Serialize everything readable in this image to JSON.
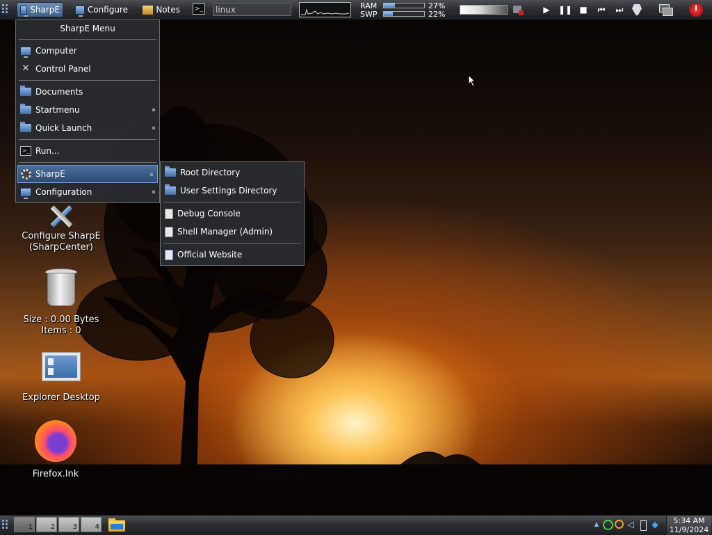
{
  "topbar": {
    "sharpe_label": "SharpE",
    "configure_label": "Configure",
    "notes_label": "Notes",
    "run_value": "linux",
    "ram_label": "RAM",
    "swp_label": "SWP",
    "ram_pct": "27%",
    "swp_pct": "22%",
    "ram_level": 0.27,
    "swp_level": 0.22,
    "volume_level": 0.45
  },
  "menu": {
    "title": "SharpE Menu",
    "items": [
      {
        "label": "Computer",
        "icon": "computer-icon"
      },
      {
        "label": "Control Panel",
        "icon": "tools-icon"
      },
      {
        "label": "Documents",
        "icon": "folder-icon"
      },
      {
        "label": "Startmenu",
        "icon": "folder-icon"
      },
      {
        "label": "Quick Launch",
        "icon": "folder-icon"
      },
      {
        "label": "Run...",
        "icon": "terminal-icon"
      },
      {
        "label": "SharpE",
        "icon": "gear-icon"
      },
      {
        "label": "Configuration",
        "icon": "computer-icon"
      }
    ]
  },
  "submenu": {
    "items": [
      {
        "label": "Root Directory",
        "icon": "folder-icon"
      },
      {
        "label": "User Settings Directory",
        "icon": "folder-icon"
      },
      {
        "label": "Debug Console",
        "icon": "document-icon"
      },
      {
        "label": "Shell Manager (Admin)",
        "icon": "document-icon"
      },
      {
        "label": "Official Website",
        "icon": "web-document-icon"
      }
    ]
  },
  "desktop": {
    "configure": {
      "line1": "Configure SharpE",
      "line2": "(SharpCenter)"
    },
    "recycle": {
      "line1": "Size : 0.00 Bytes",
      "line2": "Items : 0"
    },
    "explorer": {
      "label": "Explorer Desktop"
    },
    "firefox": {
      "label": "Firefox.lnk"
    }
  },
  "bottombar": {
    "workspaces": [
      "1",
      "2",
      "3",
      "4"
    ],
    "current_workspace": "1",
    "time": "5:34 AM",
    "date": "11/9/2024"
  },
  "colors": {
    "accent": "#4a6e9c",
    "bar": "#2a2c30"
  }
}
